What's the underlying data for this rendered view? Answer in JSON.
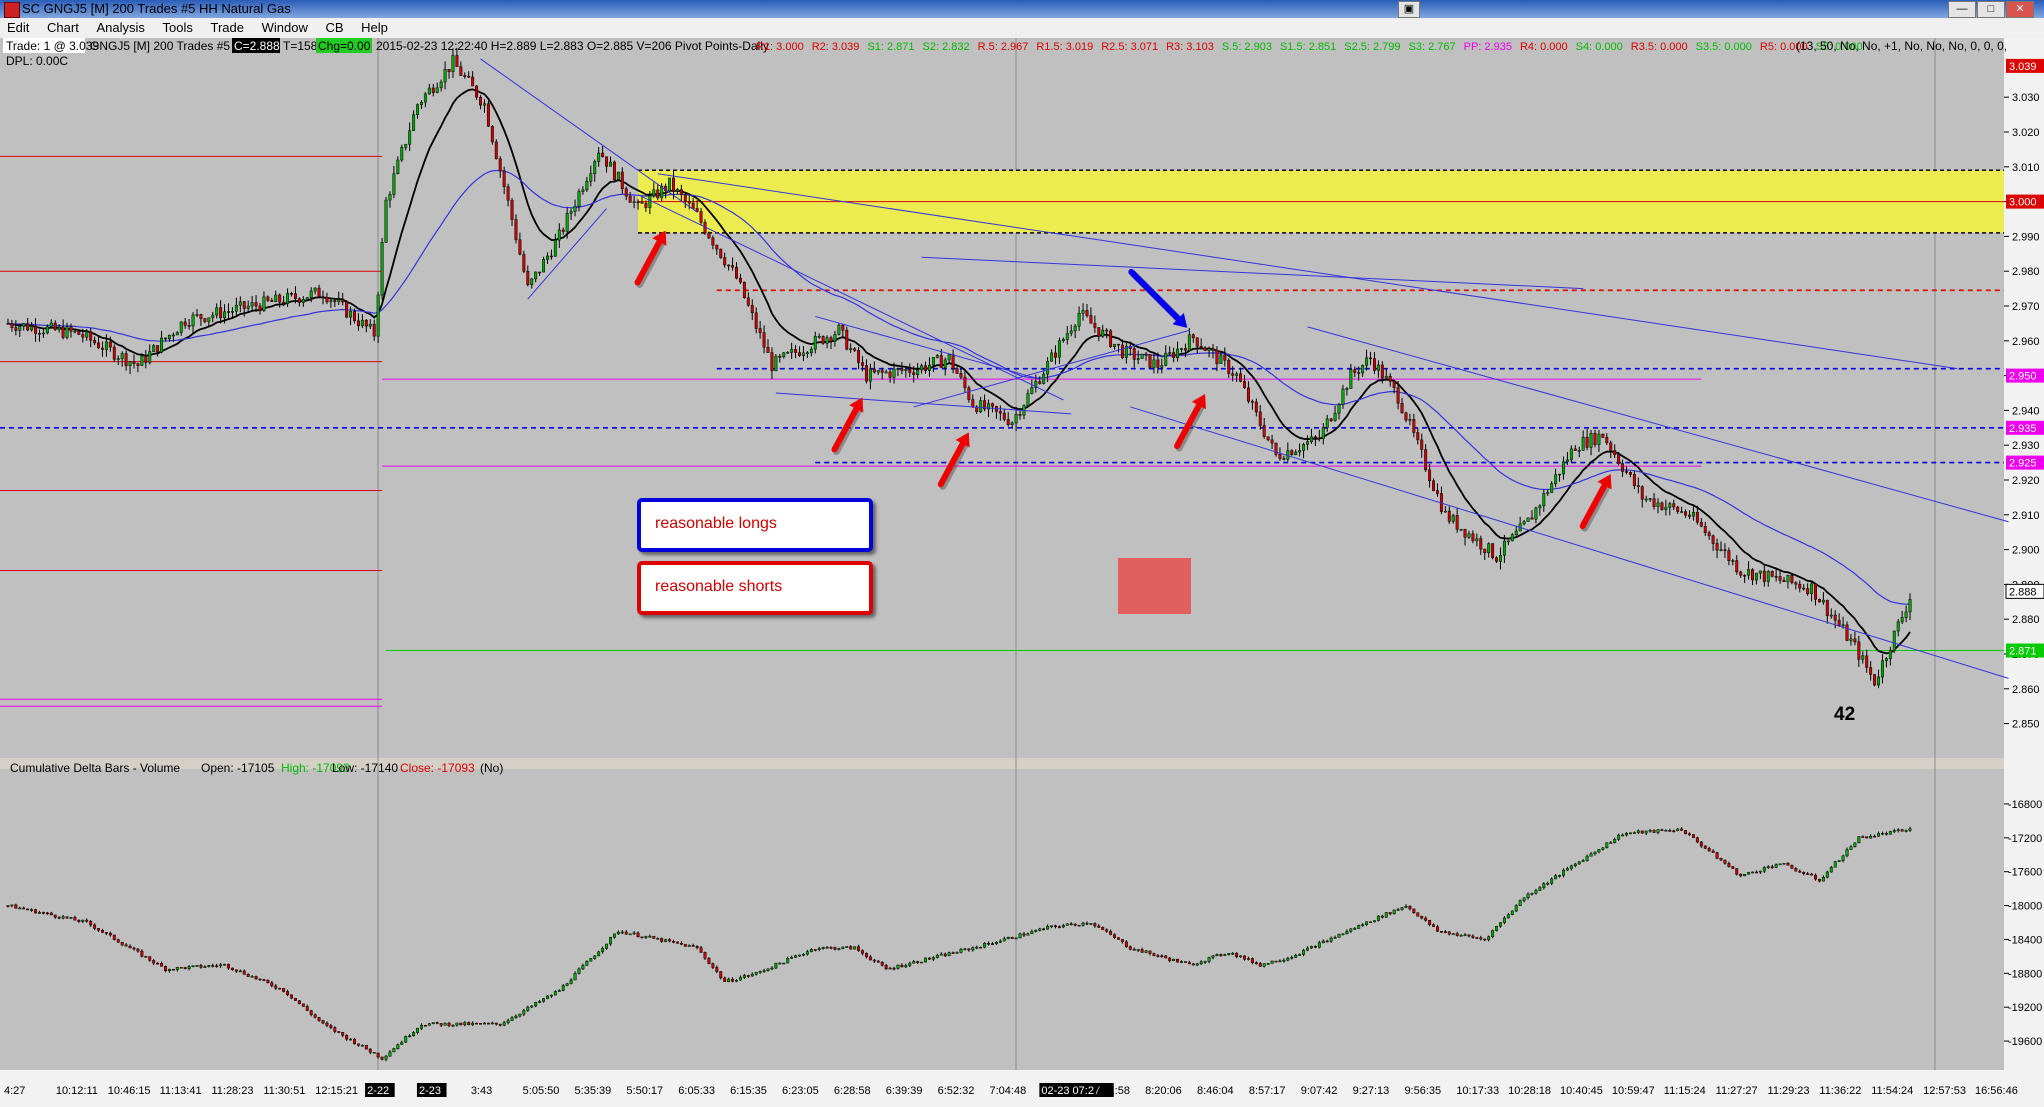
{
  "window": {
    "title": "SC GNGJ5 [M]  200 Trades  #5  HH Natural Gas"
  },
  "menu": [
    "Edit",
    "Chart",
    "Analysis",
    "Tools",
    "Trade",
    "Window",
    "CB",
    "Help"
  ],
  "info": {
    "trade": "Trade: 1 @ 3.039",
    "dpl": "DPL: 0.00C",
    "header_label": "GNGJ5 [M]  200 Trades  #5",
    "c_value": "C=2.888",
    "t_value": "T=158",
    "chg_value": "Chg=0.00",
    "ohlc": "2015-02-23 12:22:40  H=2.889  L=2.883  O=2.885  V=206  Pivot Points-Daily",
    "pivots": [
      {
        "text": "R1: 3.000",
        "color": "#dd0000"
      },
      {
        "text": "R2: 3.039",
        "color": "#dd0000"
      },
      {
        "text": "S1: 2.871",
        "color": "#00bb00"
      },
      {
        "text": "S2: 2.832",
        "color": "#00bb00"
      },
      {
        "text": "R.5: 2.967",
        "color": "#dd0000"
      },
      {
        "text": "R1.5: 3.019",
        "color": "#dd0000"
      },
      {
        "text": "R2.5: 3.071",
        "color": "#dd0000"
      },
      {
        "text": "R3: 3.103",
        "color": "#dd0000"
      },
      {
        "text": "S.5: 2.903",
        "color": "#00bb00"
      },
      {
        "text": "S1.5: 2.851",
        "color": "#00bb00"
      },
      {
        "text": "S2.5: 2.799",
        "color": "#00bb00"
      },
      {
        "text": "S3: 2.767",
        "color": "#00bb00"
      },
      {
        "text": "PP: 2.935",
        "color": "#ee00ee"
      },
      {
        "text": "R4: 0.000",
        "color": "#dd0000"
      },
      {
        "text": "S4: 0.000",
        "color": "#00bb00"
      },
      {
        "text": "R3.5: 0.000",
        "color": "#dd0000"
      },
      {
        "text": "S3.5: 0.000",
        "color": "#00bb00"
      },
      {
        "text": "R5: 0.000",
        "color": "#dd0000"
      },
      {
        "text": "S5: 0.000",
        "color": "#00bb00"
      }
    ],
    "params": "(13, 50, No, No, +1, No, No, No, 0, 0, 0,"
  },
  "lower_panel": {
    "label": "Cumulative Delta Bars - Volume",
    "open": "Open: -17105",
    "high": "High: -17093",
    "low": "Low: -17140",
    "close": "Close: -17093",
    "extra": "(No)"
  },
  "annotations": {
    "longs": "reasonable longs",
    "shorts": "reasonable shorts",
    "count": "42"
  },
  "colors": {
    "chart_bg": "#c0c0c0",
    "up_bar": "#00aa00",
    "down_bar": "#cc0000",
    "zone": "#ecec50",
    "arrow_red": "#ee0000",
    "arrow_blue": "#0000ee",
    "trendline": "#3333dd"
  },
  "chart_data": [
    {
      "type": "candlestick",
      "title": "SC GNGJ5 [M] 200 Trades #5 HH Natural Gas",
      "ylim": [
        2.845,
        3.045
      ],
      "y_ticks": [
        "3.030",
        "3.020",
        "3.010",
        "3.000",
        "2.990",
        "2.980",
        "2.970",
        "2.960",
        "2.950",
        "2.940",
        "2.930",
        "2.920",
        "2.910",
        "2.900",
        "2.890",
        "2.880",
        "2.870",
        "2.860",
        "2.850"
      ],
      "x_tick_labels": [
        "4:27",
        "10:12:11",
        "10:46:15",
        "11:13:41",
        "11:28:23",
        "11:30:51",
        "12:15:21",
        "2-22",
        "2-23",
        "3:43",
        "5:05:50",
        "5:35:39",
        "5:50:17",
        "6:05:33",
        "6:15:35",
        "6:23:05",
        "6:28:58",
        "6:39:39",
        "6:52:32",
        "7:04:48",
        "02-23 07:27",
        "7:51:58",
        "8:20:06",
        "8:46:04",
        "8:57:17",
        "9:07:42",
        "9:27:13",
        "9:56:35",
        "10:17:33",
        "10:28:18",
        "10:40:45",
        "10:59:47",
        "11:15:24",
        "11:27:27",
        "11:29:23",
        "11:36:22",
        "11:54:24",
        "12:57:53",
        "16:56:46"
      ],
      "price_markers": [
        {
          "label": "3.039",
          "value": 3.039,
          "color": "#dd0000"
        },
        {
          "label": "3.000",
          "value": 3.0,
          "color": "#dd0000"
        },
        {
          "label": "2.950",
          "value": 2.95,
          "color": "#ee00ee"
        },
        {
          "label": "2.935",
          "value": 2.935,
          "color": "#ee00ee"
        },
        {
          "label": "2.925",
          "value": 2.925,
          "color": "#ee00ee"
        },
        {
          "label": "2.888",
          "value": 2.888,
          "color": "#ffffff"
        },
        {
          "label": "2.871",
          "value": 2.871,
          "color": "#00cc00"
        }
      ],
      "levels": [
        {
          "value": 3.0,
          "style": "solid",
          "color": "#dd0000",
          "from_bar": 160
        },
        {
          "value": 2.9745,
          "style": "dashed",
          "color": "#dd0000",
          "from_bar": 180
        },
        {
          "value": 2.952,
          "style": "dashed",
          "color": "#0000dd",
          "from_bar": 180
        },
        {
          "value": 2.935,
          "style": "dashed",
          "color": "#0000dd",
          "from_bar": 0
        },
        {
          "value": 2.925,
          "style": "dashed",
          "color": "#0000dd",
          "from_bar": 205
        },
        {
          "value": 2.871,
          "style": "solid",
          "color": "#00cc00",
          "from_bar": 96
        },
        {
          "value": 3.013,
          "style": "solid",
          "color": "#dd0000",
          "from_bar": 0,
          "to_bar": 95
        },
        {
          "value": 2.98,
          "style": "solid",
          "color": "#dd0000",
          "from_bar": 0,
          "to_bar": 95
        },
        {
          "value": 2.954,
          "style": "solid",
          "color": "#dd0000",
          "from_bar": 0,
          "to_bar": 95
        },
        {
          "value": 2.917,
          "style": "solid",
          "color": "#dd0000",
          "from_bar": 0,
          "to_bar": 95
        },
        {
          "value": 2.894,
          "style": "solid",
          "color": "#dd0000",
          "from_bar": 0,
          "to_bar": 95
        },
        {
          "value": 2.857,
          "style": "solid",
          "color": "#ee00ee",
          "from_bar": 0,
          "to_bar": 95
        },
        {
          "value": 2.855,
          "style": "solid",
          "color": "#ee00ee",
          "from_bar": 0,
          "to_bar": 95
        },
        {
          "value": 2.949,
          "style": "solid",
          "color": "#ee00ee",
          "from_bar": 95,
          "to_bar": 430
        },
        {
          "value": 2.924,
          "style": "solid",
          "color": "#ee00ee",
          "from_bar": 95,
          "to_bar": 430
        }
      ],
      "zone": {
        "top": 3.009,
        "bottom": 2.991,
        "from_bar": 160
      },
      "trendlines": [
        {
          "bar1": 120,
          "v1": 3.041,
          "bar2": 175,
          "v2": 2.997
        },
        {
          "bar1": 160,
          "v1": 3.002,
          "bar2": 268,
          "v2": 2.943
        },
        {
          "bar1": 165,
          "v1": 3.008,
          "bar2": 495,
          "v2": 2.952
        },
        {
          "bar1": 232,
          "v1": 2.984,
          "bar2": 400,
          "v2": 2.975
        },
        {
          "bar1": 285,
          "v1": 2.941,
          "bar2": 508,
          "v2": 2.863
        },
        {
          "bar1": 330,
          "v1": 2.964,
          "bar2": 508,
          "v2": 2.908
        },
        {
          "bar1": 195,
          "v1": 2.945,
          "bar2": 270,
          "v2": 2.939
        },
        {
          "bar1": 205,
          "v1": 2.967,
          "bar2": 262,
          "v2": 2.949
        },
        {
          "bar1": 230,
          "v1": 2.941,
          "bar2": 300,
          "v2": 2.963
        },
        {
          "bar1": 132,
          "v1": 2.972,
          "bar2": 152,
          "v2": 2.998
        }
      ],
      "arrows": [
        {
          "type": "short",
          "bar": 168,
          "value": 2.994
        },
        {
          "type": "short",
          "bar": 218,
          "value": 2.946
        },
        {
          "type": "short",
          "bar": 245,
          "value": 2.936
        },
        {
          "type": "short",
          "bar": 305,
          "value": 2.947
        },
        {
          "type": "short",
          "bar": 408,
          "value": 2.924
        },
        {
          "type": "long",
          "bar": 301,
          "value": 2.962
        }
      ],
      "ohlc": {
        "bars": 484,
        "waypoints": [
          [
            0,
            2.965
          ],
          [
            18,
            2.962
          ],
          [
            33,
            2.953
          ],
          [
            45,
            2.966
          ],
          [
            62,
            2.97
          ],
          [
            80,
            2.974
          ],
          [
            93,
            2.962
          ],
          [
            96,
            3.0
          ],
          [
            104,
            3.028
          ],
          [
            113,
            3.04
          ],
          [
            121,
            3.028
          ],
          [
            128,
            2.995
          ],
          [
            132,
            2.975
          ],
          [
            140,
            2.99
          ],
          [
            150,
            3.015
          ],
          [
            160,
            2.998
          ],
          [
            168,
            3.005
          ],
          [
            175,
            2.996
          ],
          [
            185,
            2.978
          ],
          [
            194,
            2.953
          ],
          [
            202,
            2.958
          ],
          [
            211,
            2.963
          ],
          [
            218,
            2.95
          ],
          [
            231,
            2.952
          ],
          [
            239,
            2.955
          ],
          [
            245,
            2.942
          ],
          [
            255,
            2.937
          ],
          [
            265,
            2.955
          ],
          [
            272,
            2.968
          ],
          [
            283,
            2.957
          ],
          [
            292,
            2.953
          ],
          [
            301,
            2.961
          ],
          [
            312,
            2.95
          ],
          [
            322,
            2.927
          ],
          [
            333,
            2.932
          ],
          [
            341,
            2.95
          ],
          [
            346,
            2.955
          ],
          [
            353,
            2.944
          ],
          [
            365,
            2.91
          ],
          [
            378,
            2.898
          ],
          [
            386,
            2.908
          ],
          [
            398,
            2.93
          ],
          [
            405,
            2.933
          ],
          [
            415,
            2.915
          ],
          [
            427,
            2.91
          ],
          [
            440,
            2.894
          ],
          [
            458,
            2.889
          ],
          [
            469,
            2.872
          ],
          [
            474,
            2.862
          ],
          [
            484,
            2.889
          ]
        ]
      },
      "moving_averages": [
        {
          "name": "EMA13",
          "color": "#000000"
        },
        {
          "name": "EMA50",
          "color": "#3333dd"
        }
      ]
    },
    {
      "type": "candlestick",
      "title": "Cumulative Delta Bars - Volume",
      "ylim": [
        -19800,
        -16600
      ],
      "y_ticks": [
        "-16800",
        "-17200",
        "-17600",
        "-18000",
        "-18400",
        "-18800",
        "-19200",
        "-19600"
      ],
      "ohlc": {
        "bars": 484,
        "waypoints": [
          [
            0,
            -18000
          ],
          [
            20,
            -18200
          ],
          [
            40,
            -18750
          ],
          [
            55,
            -18700
          ],
          [
            70,
            -19000
          ],
          [
            80,
            -19400
          ],
          [
            95,
            -19800
          ],
          [
            105,
            -19400
          ],
          [
            125,
            -19400
          ],
          [
            140,
            -19000
          ],
          [
            155,
            -18300
          ],
          [
            175,
            -18500
          ],
          [
            182,
            -18900
          ],
          [
            190,
            -18800
          ],
          [
            205,
            -18500
          ],
          [
            215,
            -18500
          ],
          [
            223,
            -18750
          ],
          [
            245,
            -18500
          ],
          [
            265,
            -18250
          ],
          [
            275,
            -18200
          ],
          [
            285,
            -18500
          ],
          [
            300,
            -18700
          ],
          [
            310,
            -18550
          ],
          [
            318,
            -18700
          ],
          [
            326,
            -18600
          ],
          [
            345,
            -18200
          ],
          [
            355,
            -18000
          ],
          [
            363,
            -18300
          ],
          [
            375,
            -18400
          ],
          [
            385,
            -17900
          ],
          [
            395,
            -17600
          ],
          [
            410,
            -17150
          ],
          [
            425,
            -17100
          ],
          [
            440,
            -17650
          ],
          [
            450,
            -17500
          ],
          [
            460,
            -17700
          ],
          [
            470,
            -17200
          ],
          [
            484,
            -17093
          ]
        ]
      }
    }
  ]
}
